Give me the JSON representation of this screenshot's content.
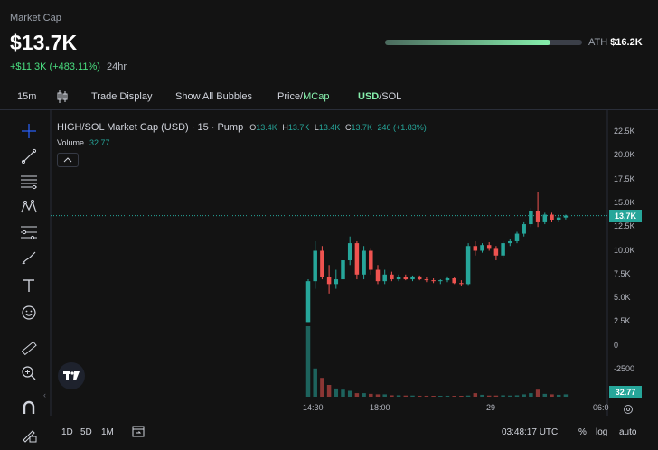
{
  "header": {
    "market_cap_label": "Market Cap",
    "market_cap_value": "$13.7K",
    "change_abs": "+$11.3K",
    "change_pct": "(+483.11%)",
    "change_period": "24hr",
    "ath_label": "ATH",
    "ath_value": "$16.2K",
    "ath_progress": 0.84
  },
  "toolbar": {
    "interval": "15m",
    "trade_display": "Trade Display",
    "show_bubbles": "Show All Bubbles",
    "price_label": "Price/",
    "mcap_label": "MCap",
    "usd_label": "USD",
    "sol_label": "/SOL"
  },
  "chart": {
    "title": "HIGH/SOL Market Cap (USD) · 15 · Pump",
    "ohlc": {
      "o_label": "O",
      "o": "13.4K",
      "h_label": "H",
      "h": "13.7K",
      "l_label": "L",
      "l": "13.4K",
      "c_label": "C",
      "c": "13.7K",
      "change": "246 (+1.83%)"
    },
    "volume_label": "Volume",
    "volume_value": "32.77",
    "last_price": "13.7K",
    "volume_tag": "32.77"
  },
  "colors": {
    "up": "#26a69a",
    "down": "#ef5350",
    "accent": "#86efac",
    "bg": "#131313"
  },
  "chart_data": {
    "type": "candlestick",
    "y_ticks": [
      "22.5K",
      "20.0K",
      "17.5K",
      "15.0K",
      "12.5K",
      "10.0K",
      "7.5K",
      "5.0K",
      "2.5K",
      "0",
      "-2500"
    ],
    "x_ticks": [
      "14:30",
      "18:00",
      "29",
      "06:0"
    ],
    "ylim": [
      -2500,
      22500
    ],
    "candles": [
      {
        "o": 2.5,
        "h": 7.0,
        "l": 2.5,
        "c": 6.8
      },
      {
        "o": 6.8,
        "h": 11.0,
        "l": 6.0,
        "c": 10.0
      },
      {
        "o": 10.0,
        "h": 10.5,
        "l": 7.0,
        "c": 7.2
      },
      {
        "o": 7.2,
        "h": 8.5,
        "l": 5.5,
        "c": 6.5
      },
      {
        "o": 6.5,
        "h": 8.0,
        "l": 6.0,
        "c": 7.0
      },
      {
        "o": 7.0,
        "h": 11.0,
        "l": 6.5,
        "c": 9.0
      },
      {
        "o": 9.0,
        "h": 11.5,
        "l": 8.5,
        "c": 10.8
      },
      {
        "o": 10.8,
        "h": 11.0,
        "l": 7.0,
        "c": 7.5
      },
      {
        "o": 7.5,
        "h": 10.5,
        "l": 7.0,
        "c": 10.0
      },
      {
        "o": 10.0,
        "h": 10.2,
        "l": 7.5,
        "c": 8.0
      },
      {
        "o": 8.0,
        "h": 8.5,
        "l": 6.5,
        "c": 6.8
      },
      {
        "o": 6.8,
        "h": 8.0,
        "l": 6.5,
        "c": 7.5
      },
      {
        "o": 7.5,
        "h": 7.8,
        "l": 6.8,
        "c": 7.0
      },
      {
        "o": 7.0,
        "h": 7.5,
        "l": 6.8,
        "c": 7.2
      },
      {
        "o": 7.2,
        "h": 7.5,
        "l": 6.9,
        "c": 7.0
      },
      {
        "o": 7.0,
        "h": 7.4,
        "l": 6.8,
        "c": 7.3
      },
      {
        "o": 7.3,
        "h": 7.4,
        "l": 6.9,
        "c": 7.0
      },
      {
        "o": 7.0,
        "h": 7.2,
        "l": 6.7,
        "c": 6.9
      },
      {
        "o": 6.9,
        "h": 7.1,
        "l": 6.6,
        "c": 6.8
      },
      {
        "o": 6.8,
        "h": 7.0,
        "l": 6.5,
        "c": 6.9
      },
      {
        "o": 6.9,
        "h": 7.3,
        "l": 6.7,
        "c": 7.1
      },
      {
        "o": 7.1,
        "h": 7.2,
        "l": 6.5,
        "c": 6.6
      },
      {
        "o": 6.6,
        "h": 6.9,
        "l": 6.3,
        "c": 6.5
      },
      {
        "o": 6.5,
        "h": 10.8,
        "l": 6.4,
        "c": 10.5
      },
      {
        "o": 10.5,
        "h": 11.0,
        "l": 9.5,
        "c": 10.0
      },
      {
        "o": 10.0,
        "h": 10.8,
        "l": 9.8,
        "c": 10.6
      },
      {
        "o": 10.6,
        "h": 10.9,
        "l": 10.0,
        "c": 10.2
      },
      {
        "o": 10.2,
        "h": 10.5,
        "l": 9.0,
        "c": 9.5
      },
      {
        "o": 9.5,
        "h": 11.0,
        "l": 9.2,
        "c": 10.8
      },
      {
        "o": 10.8,
        "h": 11.2,
        "l": 10.5,
        "c": 11.0
      },
      {
        "o": 11.0,
        "h": 12.0,
        "l": 10.8,
        "c": 11.8
      },
      {
        "o": 11.8,
        "h": 13.0,
        "l": 11.5,
        "c": 12.8
      },
      {
        "o": 12.8,
        "h": 14.5,
        "l": 12.5,
        "c": 14.2
      },
      {
        "o": 14.2,
        "h": 16.2,
        "l": 12.5,
        "c": 13.0
      },
      {
        "o": 13.0,
        "h": 14.0,
        "l": 12.8,
        "c": 13.8
      },
      {
        "o": 13.8,
        "h": 14.0,
        "l": 13.0,
        "c": 13.2
      },
      {
        "o": 13.2,
        "h": 13.8,
        "l": 13.0,
        "c": 13.5
      },
      {
        "o": 13.5,
        "h": 13.8,
        "l": 13.3,
        "c": 13.7
      }
    ],
    "volumes": [
      3,
      1.2,
      0.8,
      0.5,
      0.35,
      0.3,
      0.25,
      0.15,
      0.15,
      0.12,
      0.1,
      0.1,
      0.06,
      0.06,
      0.05,
      0.05,
      0.04,
      0.04,
      0.03,
      0.03,
      0.04,
      0.03,
      0.03,
      0.05,
      0.15,
      0.08,
      0.05,
      0.05,
      0.06,
      0.05,
      0.06,
      0.1,
      0.15,
      0.3,
      0.12,
      0.1,
      0.08,
      0.1
    ]
  },
  "price_axis_labels": [
    "22.5K",
    "20.0K",
    "17.5K",
    "15.0K",
    "12.5K",
    "10.0K",
    "7.5K",
    "5.0K",
    "2.5K",
    "0",
    "-2500"
  ],
  "time_axis_labels": [
    "14:30",
    "18:00",
    "29",
    "06:0"
  ],
  "footer": {
    "range_1d": "1D",
    "range_5d": "5D",
    "range_1m": "1M",
    "clock": "03:48:17 UTC",
    "pct": "%",
    "log": "log",
    "auto": "auto"
  }
}
